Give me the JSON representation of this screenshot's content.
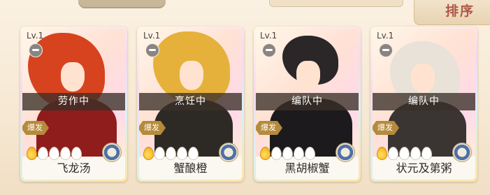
{
  "header": {
    "sort_label": "排序"
  },
  "cards": [
    {
      "level": "Lv.1",
      "status": "劳作中",
      "tag": "爆发",
      "rarity_filled": 1,
      "rarity_total": 5,
      "name": "飞龙汤",
      "colors": {
        "hair": "#d7431f",
        "body": "#8f1d1b"
      }
    },
    {
      "level": "Lv.1",
      "status": "烹饪中",
      "tag": "爆发",
      "rarity_filled": 1,
      "rarity_total": 5,
      "name": "蟹酿橙",
      "colors": {
        "hair": "#e6b13b",
        "body": "#2d2a26"
      }
    },
    {
      "level": "Lv.1",
      "status": "编队中",
      "tag": "爆发",
      "rarity_filled": 1,
      "rarity_total": 5,
      "name": "黑胡椒蟹",
      "colors": {
        "hair": "#2b2628",
        "body": "#1c1a1c"
      }
    },
    {
      "level": "Lv.1",
      "status": "编队中",
      "tag": "爆发",
      "rarity_filled": 1,
      "rarity_total": 5,
      "name": "状元及第粥",
      "colors": {
        "hair": "#e8e2d9",
        "body": "#3a3433"
      }
    }
  ]
}
